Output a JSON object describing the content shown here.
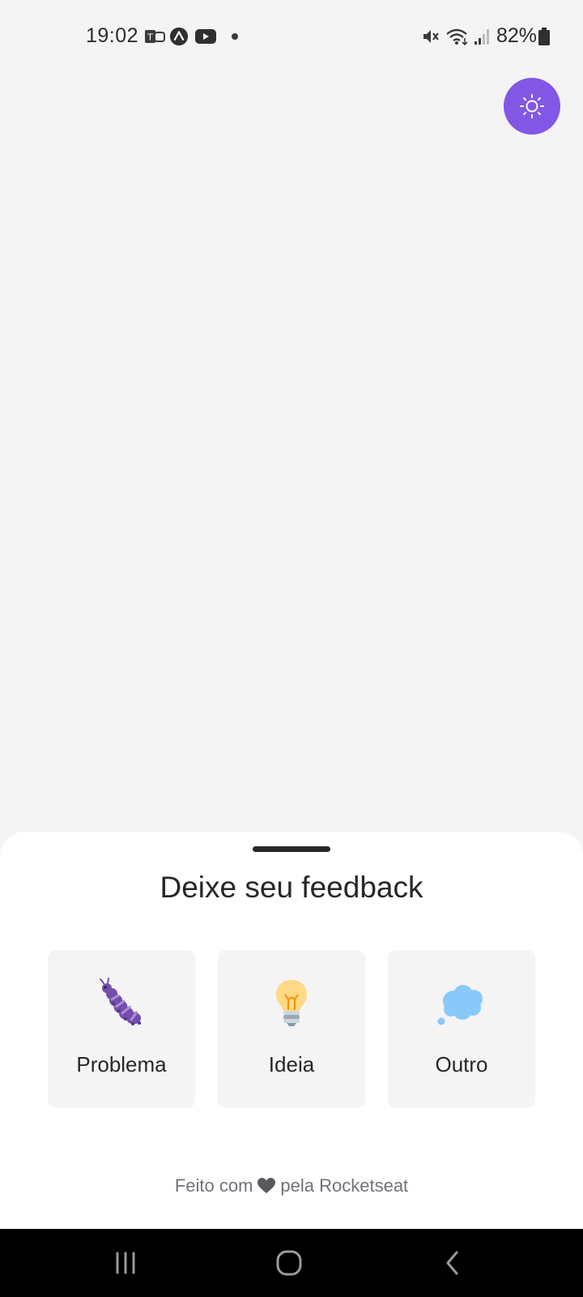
{
  "status_bar": {
    "time": "19:02",
    "battery_percent": "82%",
    "left_icons": [
      "teams-icon",
      "expo-icon",
      "youtube-icon",
      "notification-dot"
    ],
    "right_icons": [
      "vibrate-mute-icon",
      "wifi-icon",
      "signal-icon",
      "battery-icon"
    ]
  },
  "theme_toggle": {
    "icon": "sun-icon",
    "color": "#8257e6"
  },
  "sheet": {
    "title": "Deixe seu feedback",
    "options": [
      {
        "label": "Problema",
        "icon": "bug-icon"
      },
      {
        "label": "Ideia",
        "icon": "lightbulb-icon"
      },
      {
        "label": "Outro",
        "icon": "thought-cloud-icon"
      }
    ],
    "footer": {
      "prefix": "Feito com",
      "suffix": "pela Rocketseat",
      "icon": "heart-icon"
    }
  },
  "nav_bar": {
    "buttons": [
      "recent-apps-icon",
      "home-icon",
      "back-icon"
    ]
  },
  "colors": {
    "accent": "#8257e6",
    "background": "#f4f4f5",
    "surface": "#ffffff",
    "text": "#27272a",
    "muted_text": "#71717a"
  }
}
